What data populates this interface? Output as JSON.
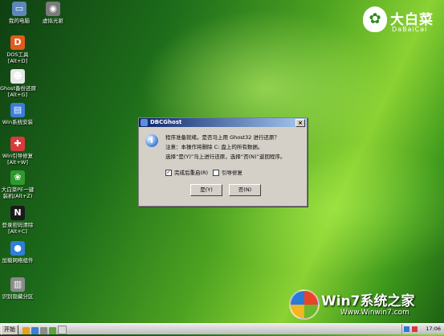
{
  "desktop": {
    "icons": [
      {
        "id": "my-computer",
        "label1": "我的电脑",
        "label2": "",
        "icon": "computer-icon",
        "glyph": "▭",
        "color": "#5f86b8"
      },
      {
        "id": "virtual-cd",
        "label1": "虚拟光驱",
        "label2": "",
        "icon": "cd-drive-icon",
        "glyph": "◉",
        "color": "#7b7b7b"
      },
      {
        "id": "dos-tools",
        "label1": "DOS工具",
        "label2": "[Alt+D]",
        "icon": "dos-tool-icon",
        "glyph": "D",
        "color": "#e25b1b"
      },
      {
        "id": "ghost-restore",
        "label1": "Ghost备份还原",
        "label2": "[Alt+G]",
        "icon": "ghost-icon",
        "glyph": "☻",
        "color": "#e7e7e7"
      },
      {
        "id": "win-install",
        "label1": "Win系统安装",
        "label2": "",
        "icon": "install-icon",
        "glyph": "▤",
        "color": "#3b7dd8"
      },
      {
        "id": "win-boot-repair",
        "label1": "Win引导修复",
        "label2": "[Alt+W]",
        "icon": "repair-icon",
        "glyph": "✚",
        "color": "#d83b3b"
      },
      {
        "id": "dabaicai-pe",
        "label1": "大白菜PE一键",
        "label2": "装机(Alt+Z)",
        "icon": "cabbage-icon",
        "glyph": "❀",
        "color": "#2e9a2e"
      },
      {
        "id": "password-clear",
        "label1": "登录密码清除",
        "label2": "[Alt+C]",
        "icon": "nt-password-icon",
        "glyph": "N",
        "color": "#1a1a1a"
      },
      {
        "id": "network",
        "label1": "加载网络组件",
        "label2": "",
        "icon": "network-globe-icon",
        "glyph": "●",
        "color": "#2f7fd6"
      },
      {
        "id": "partition",
        "label1": "识别隐藏分区",
        "label2": "",
        "icon": "disk-icon",
        "glyph": "▥",
        "color": "#8a8a8a"
      }
    ]
  },
  "logo": {
    "title": "大白菜",
    "subtitle": "DaBaiCai"
  },
  "dialog": {
    "title": "DBCGhost",
    "close": "×",
    "line1": "程序准备就绪，是否马上用 Ghost32 进行还原？",
    "line2": "注意：本操作将删除 C: 盘上的所有数据。",
    "line3": "选择“是(Y)”马上进行还原，选择“否(N)”返回程序。",
    "check_reboot": "完成后重启(R)",
    "check_reboot_checked": true,
    "check_repair": "引导修复",
    "check_repair_checked": false,
    "yes": "是(Y)",
    "no": "否(N)"
  },
  "taskbar": {
    "start": "开始",
    "clock": "17:06"
  },
  "watermark": {
    "main": "Win7系统之家",
    "url": "Www.Winwin7.com"
  }
}
